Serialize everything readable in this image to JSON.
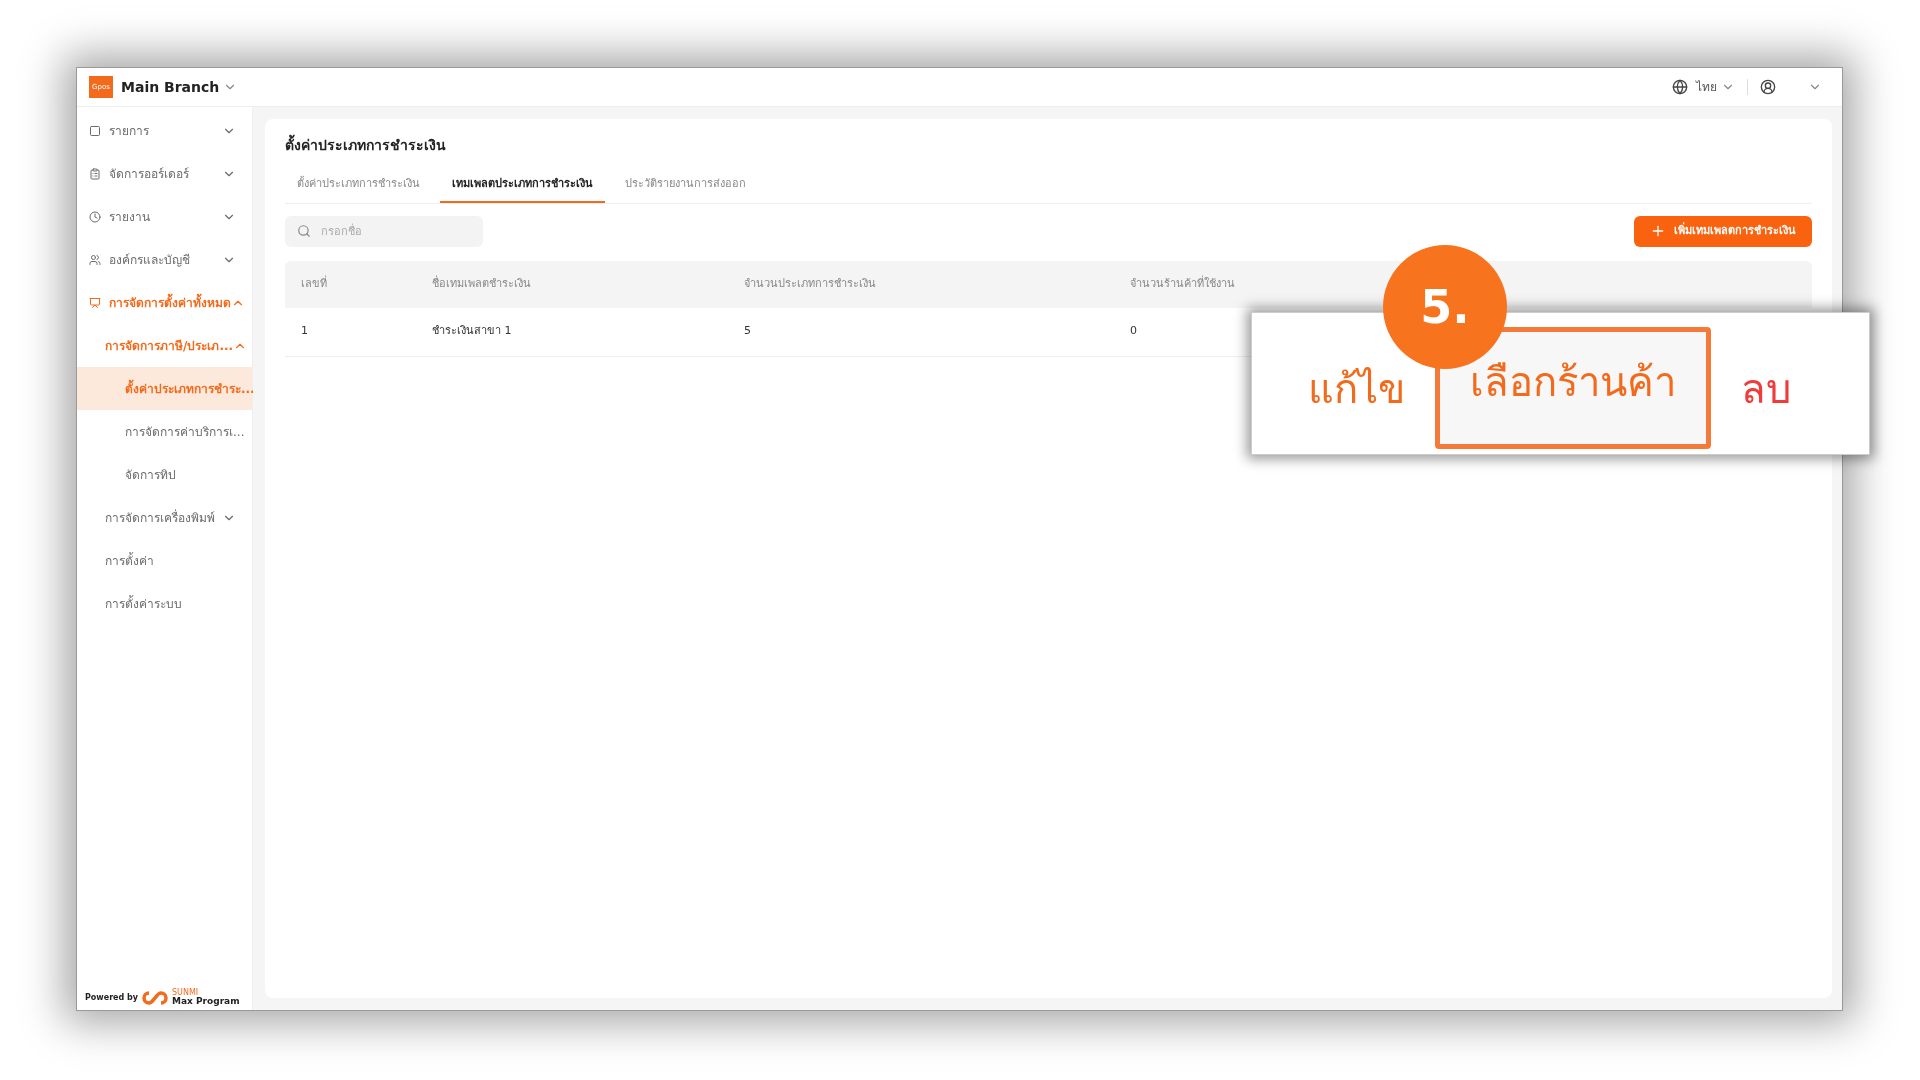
{
  "header": {
    "logo_text": "Gpos",
    "branch": "Main Branch",
    "language": "ไทย"
  },
  "sidebar": {
    "items": [
      {
        "label": "รายการ",
        "expanded": false
      },
      {
        "label": "จัดการออร์เดอร์",
        "expanded": false
      },
      {
        "label": "รายงาน",
        "expanded": false
      },
      {
        "label": "องค์กรและบัญชี",
        "expanded": false
      },
      {
        "label": "การจัดการตั้งค่าทั้งหมด",
        "expanded": true,
        "children": [
          {
            "label": "การจัดการภาษี/ประเภ...",
            "expanded": true,
            "children": [
              {
                "label": "ตั้งค่าประเภทการชำระ...",
                "selected": true
              },
              {
                "label": "การจัดการค่าบริการเ...",
                "selected": false
              },
              {
                "label": "จัดการทิป",
                "selected": false
              }
            ]
          },
          {
            "label": "การจัดการเครื่องพิมพ์",
            "expanded": false
          },
          {
            "label": "การตั้งค่า",
            "selected": false
          },
          {
            "label": "การตั้งค่าระบบ",
            "selected": false
          }
        ]
      }
    ],
    "footer": {
      "powered_by": "Powered by",
      "brand_small": "SUNMI",
      "brand": "Max Program"
    }
  },
  "page": {
    "title": "ตั้งค่าประเภทการชำระเงิน",
    "tabs": [
      {
        "label": "ตั้งค่าประเภทการชำระเงิน",
        "selected": false
      },
      {
        "label": "เทมเพลตประเภทการชำระเงิน",
        "selected": true
      },
      {
        "label": "ประวัติรายงานการส่งออก",
        "selected": false
      }
    ],
    "search": {
      "placeholder": "กรอกชื่อ"
    },
    "add_button": "เพิ่มเทมเพลตการชำระเงิน",
    "table": {
      "columns": [
        "เลขที่",
        "ชื่อเทมเพลตชำระเงิน",
        "จำนวนประเภทการชำระเงิน",
        "จำนวนร้านค้าที่ใช้งาน"
      ],
      "rows": [
        [
          "1",
          "ชำระเงินสาขา 1",
          "5",
          "0"
        ]
      ]
    }
  },
  "callout": {
    "step": "5.",
    "actions": [
      {
        "label": "แก้ไข",
        "kind": "edit",
        "highlighted": false
      },
      {
        "label": "เลือกร้านค้า",
        "kind": "select",
        "highlighted": true
      },
      {
        "label": "ลบ",
        "kind": "delete",
        "highlighted": false
      }
    ]
  }
}
